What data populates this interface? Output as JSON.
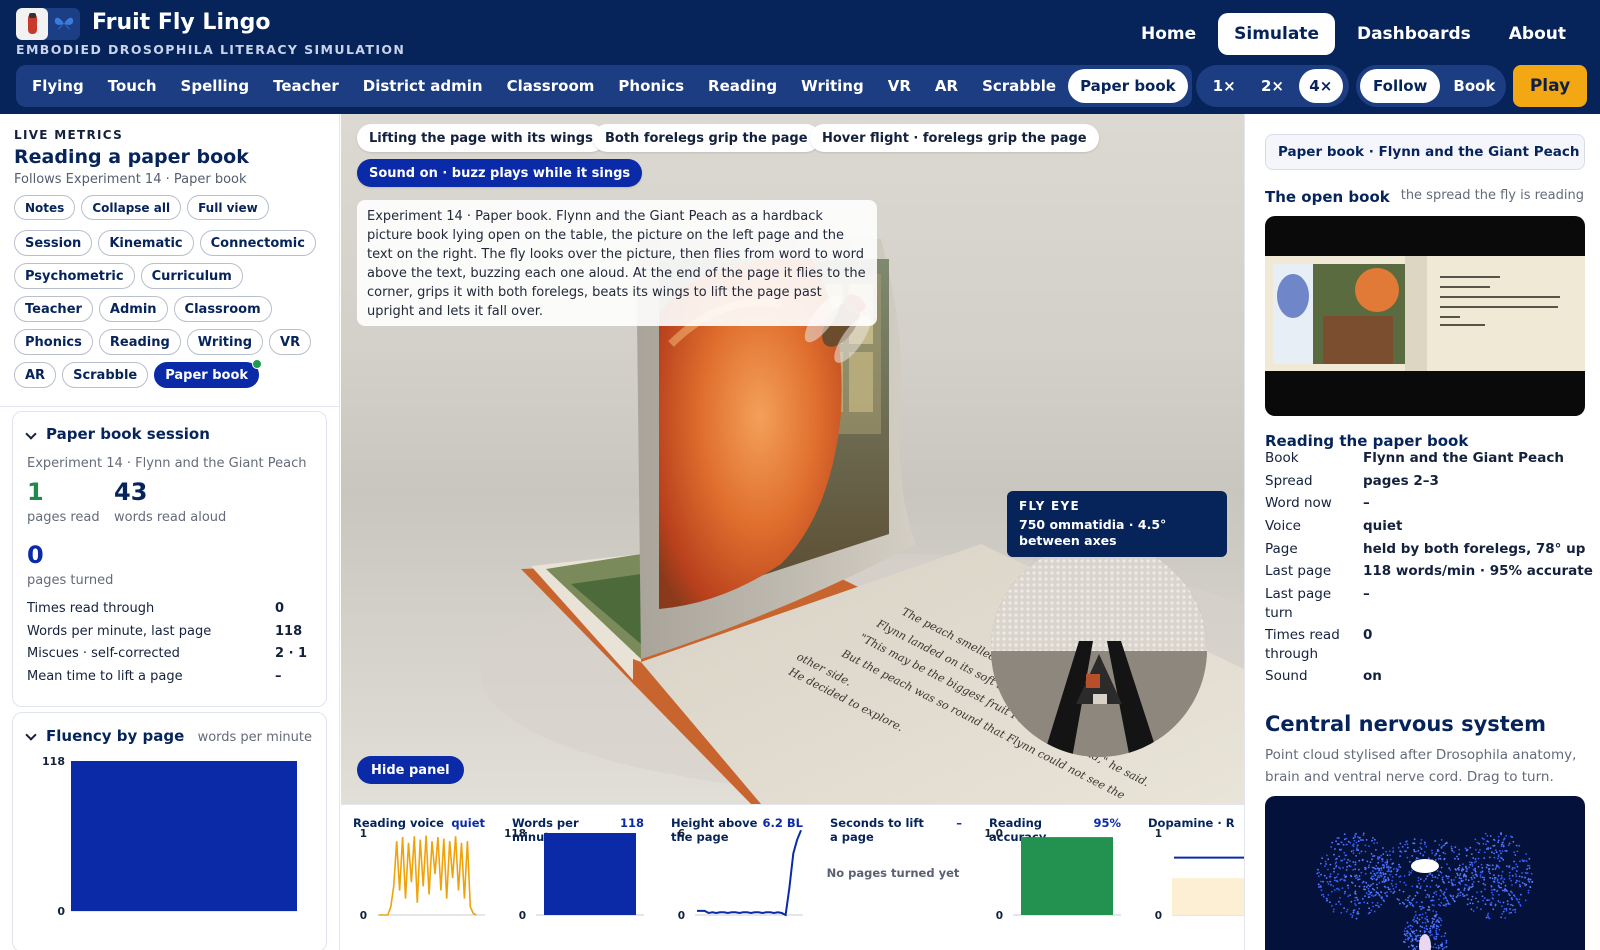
{
  "app": {
    "title": "Fruit Fly Lingo",
    "subtitle": "EMBODIED DROSOPHILA LITERACY SIMULATION",
    "logo_icon": "test-tube-butterfly-icon"
  },
  "topnav": [
    "Home",
    "Simulate",
    "Dashboards",
    "About"
  ],
  "topnav_active": "Simulate",
  "modes": [
    "Flying",
    "Touch",
    "Spelling",
    "Teacher",
    "District admin",
    "Classroom",
    "Phonics",
    "Reading",
    "Writing",
    "VR",
    "AR",
    "Scrabble",
    "Paper book"
  ],
  "mode_active": "Paper book",
  "speeds": [
    "1×",
    "2×",
    "4×"
  ],
  "speed_active": "4×",
  "views": [
    "Follow",
    "Book"
  ],
  "view_active": "Follow",
  "play_label": "Play",
  "colors": {
    "navy": "#06245a",
    "accent": "#0a2aa8",
    "play": "#f3a712",
    "green": "#1e8b4a",
    "voice": "#f0a20b"
  },
  "left": {
    "eyebrow": "LIVE METRICS",
    "title": "Reading a paper book",
    "follows": "Follows Experiment 14 · Paper book",
    "view_buttons": [
      "Notes",
      "Collapse all",
      "Full view"
    ],
    "sections": [
      "Session",
      "Kinematic",
      "Connectomic",
      "Psychometric",
      "Curriculum",
      "Teacher",
      "Admin",
      "Classroom",
      "Phonics",
      "Reading",
      "Writing",
      "VR",
      "AR",
      "Scrabble",
      "Paper book"
    ],
    "section_active": "Paper book",
    "session": {
      "title": "Paper book session",
      "subtitle": "Experiment 14 · Flynn and the Giant Peach",
      "pages_read": "1",
      "pages_read_label": "pages read",
      "words_read": "43",
      "words_read_label": "words read aloud",
      "pages_turned": "0",
      "pages_turned_label": "pages turned",
      "stats": [
        {
          "label": "Times read through",
          "value": "0"
        },
        {
          "label": "Words per minute, last page",
          "value": "118"
        },
        {
          "label": "Miscues · self-corrected",
          "value": "2 · 1"
        },
        {
          "label": "Mean time to lift a page",
          "value": "–"
        }
      ]
    },
    "fluency": {
      "title": "Fluency by page",
      "unit": "words per minute"
    }
  },
  "scene": {
    "chips": [
      "Lifting the page with its wings",
      "Both forelegs grip the page",
      "Hover flight · forelegs grip the page"
    ],
    "sound_chip": "Sound on · buzz plays while it sings",
    "description": "Experiment 14 · Paper book. Flynn and the Giant Peach as a hardback picture book lying open on the table, the picture on the left page and the text on the right. The fly looks over the picture, then flies from word to word above the text, buzzing each one aloud. At the end of the page it flies to the corner, grips it with both forelegs, beats its wings to lift the page past upright and lets it fall over.",
    "hide_panel": "Hide panel",
    "fly_eye_title": "FLY EYE",
    "fly_eye_desc": "750 ommatidia · 4.5° between axes",
    "book_text_lines": [
      "The peach smelled wonderful.",
      "Flynn landed on its soft skin.",
      "\"This may be the biggest fruit I have ever found,\" he said.",
      "But the peach was so round that Flynn could not see the",
      "other side.",
      "He decided to explore."
    ]
  },
  "minicharts": [
    {
      "title": "Reading voice",
      "value": "quiet",
      "y_max": "1",
      "y_min": "0"
    },
    {
      "title": "Words per minute",
      "value": "118",
      "y_max": "118",
      "y_min": "0"
    },
    {
      "title": "Height above the page",
      "value": "6.2 BL",
      "y_max": "6",
      "y_min": "0"
    },
    {
      "title": "Seconds to lift a page",
      "value": "–",
      "empty": "No pages turned yet"
    },
    {
      "title": "Reading accuracy",
      "value": "95%",
      "y_max": "1.0",
      "y_min": "0"
    },
    {
      "title": "Dopamine · R",
      "value": "",
      "y_max": "1",
      "y_min": "0"
    }
  ],
  "right": {
    "book_tag": "Paper book · Flynn and the Giant Peach",
    "open_book_title": "The open book",
    "open_book_note": "the spread the fly is reading",
    "reading_title": "Reading the paper book",
    "fields": [
      {
        "k": "Book",
        "v": "Flynn and the Giant Peach"
      },
      {
        "k": "Spread",
        "v": "pages 2–3"
      },
      {
        "k": "Word now",
        "v": "–"
      },
      {
        "k": "Voice",
        "v": "quiet"
      },
      {
        "k": "Page",
        "v": "held by both forelegs, 78° up"
      },
      {
        "k": "Last page",
        "v": "118 words/min · 95% accurate"
      },
      {
        "k": "Last page turn",
        "v": "–"
      },
      {
        "k": "Times read through",
        "v": "0"
      },
      {
        "k": "Sound",
        "v": "on"
      }
    ],
    "cns_title": "Central nervous system",
    "cns_desc": "Point cloud stylised after Drosophila anatomy, brain and ventral nerve cord. Drag to turn."
  },
  "chart_data": [
    {
      "type": "bar",
      "title": "Fluency by page",
      "ylabel": "words per minute",
      "categories": [
        ""
      ],
      "values": [
        118
      ],
      "y_tick_labels": [
        "118",
        "0"
      ],
      "ylim": [
        0,
        118
      ]
    },
    {
      "type": "line",
      "title": "Reading voice",
      "ylim": [
        0,
        1
      ],
      "values": [
        0,
        0,
        0,
        0,
        0.1,
        0.35,
        0.9,
        0.3,
        0.95,
        0.2,
        0.88,
        0.4,
        0.96,
        0.15,
        0.92,
        0.35,
        0.97,
        0.25,
        0.9,
        0.5,
        0.95,
        0.3,
        0.93,
        0.2,
        0.9,
        0.45,
        0.96,
        0.3,
        0.88,
        0.2,
        0.9,
        0.1,
        0.02,
        0.0
      ]
    },
    {
      "type": "bar",
      "title": "Words per minute",
      "categories": [
        ""
      ],
      "values": [
        118
      ],
      "ylim": [
        0,
        118
      ]
    },
    {
      "type": "line",
      "title": "Height above the page",
      "ylim": [
        0,
        6
      ],
      "values": [
        0.3,
        0.3,
        0.3,
        0.15,
        0.2,
        0.15,
        0.2,
        0.2,
        0.15,
        0.2,
        0.2,
        0.15,
        0.2,
        0.2,
        0.15,
        0.2,
        0.2,
        0.15,
        0.2,
        0.2,
        0.15,
        0.2,
        0.15,
        0.0,
        2.0,
        4.5,
        5.5,
        6.2
      ]
    },
    {
      "type": "bar",
      "title": "Reading accuracy",
      "categories": [
        ""
      ],
      "values": [
        0.95
      ],
      "ylim": [
        0,
        1.0
      ]
    },
    {
      "type": "line",
      "title": "Dopamine · R",
      "ylim": [
        0,
        1
      ],
      "values": [
        0.7,
        0.7,
        0.7
      ]
    }
  ]
}
